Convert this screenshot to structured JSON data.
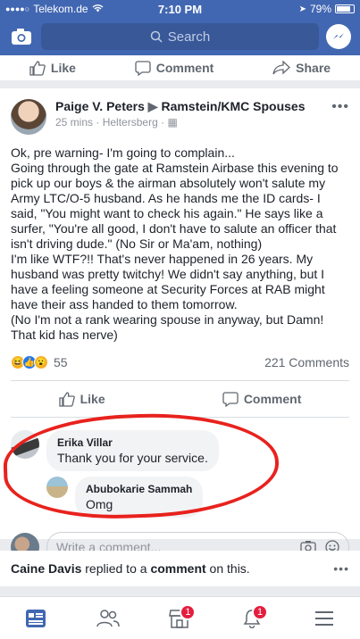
{
  "status_bar": {
    "carrier": "Telekom.de",
    "time": "7:10 PM",
    "battery": "79%"
  },
  "top_bar": {
    "search_placeholder": "Search",
    "brand_color": "#4267b2"
  },
  "prev_card_actions": {
    "like": "Like",
    "comment": "Comment",
    "share": "Share"
  },
  "post": {
    "author": "Paige V. Peters",
    "group": "Ramstein/KMC Spouses",
    "time": "25 mins",
    "location": "Heltersberg",
    "body": "Ok, pre warning- I'm going to complain...\nGoing through the gate at Ramstein Airbase this evening to pick up our boys & the airman absolutely won't salute my Army LTC/O-5 husband.  As he hands me the ID cards- I said, \"You might want to check his again.\" He says like a surfer, \"You're all good, I don't have to salute an officer that isn't driving dude.\" (No Sir or Ma'am, nothing)\nI'm like WTF?!! That's never happened in 26 years. My husband was pretty twitchy! We didn't say anything, but I have a feeling someone at Security Forces at RAB might have their ass handed to them tomorrow.\n(No I'm not a rank wearing spouse in anyway, but Damn! That kid has nerve)",
    "reaction_count": "55",
    "comment_count": "221 Comments",
    "like_label": "Like",
    "comment_label": "Comment"
  },
  "comments": [
    {
      "name": "Erika Villar",
      "text": "Thank you for your service."
    },
    {
      "name": "Abubokarie Sammah",
      "text": "Omg"
    }
  ],
  "write_comment_placeholder": "Write a comment...",
  "notification": {
    "name": "Caine Davis",
    "middle": " replied to a ",
    "strong": "comment",
    "end": " on this."
  },
  "tab_bar": {
    "marketplace_badge": "1",
    "notifications_badge": "1"
  }
}
